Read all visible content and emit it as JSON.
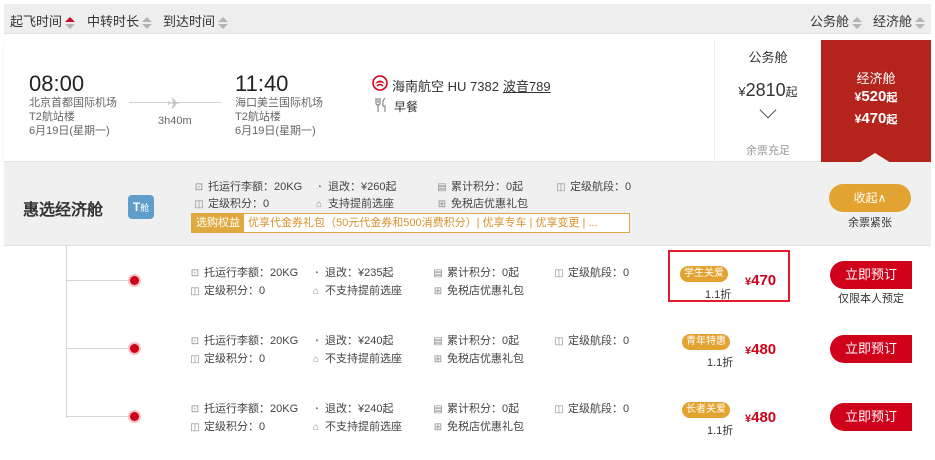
{
  "sort_bar": {
    "departure": "起飞时间",
    "transfer": "中转时长",
    "arrival": "到达时间",
    "business": "公务舱",
    "economy": "经济舱"
  },
  "flight": {
    "dep_time": "08:00",
    "dep_airport": "北京首都国际机场",
    "dep_terminal": "T2航站楼",
    "dep_date": "6月19日(星期一)",
    "duration": "3h40m",
    "arr_time": "11:40",
    "arr_airport": "海口美兰国际机场",
    "arr_terminal": "T2航站楼",
    "arr_date": "6月19日(星期一)",
    "airline": "海南航空 HU 7382",
    "aircraft": "波音789",
    "meal": "早餐",
    "business": {
      "label": "公务舱",
      "currency": "¥",
      "price": "2810",
      "suffix": "起",
      "seats": "余票充足"
    },
    "economy": {
      "label": "经济舱",
      "currency": "¥",
      "price1": "520",
      "price2": "470",
      "suffix": "起"
    }
  },
  "cabin": {
    "title": "惠选经济舱",
    "badge": "T",
    "badge_sub": "舱",
    "attrs": {
      "baggage": "托运行李额：20KG",
      "refund": "退改：¥260起",
      "points": "累计积分：0起",
      "segment": "定级航段：0",
      "grade_points": "定级积分：0",
      "seat": "支持提前选座",
      "dutyfree": "免税店优惠礼包"
    },
    "perk_tag": "选购权益",
    "perk_text": "优享代金券礼包（50元代金券和500消费积分）| 优享专车 | 优享变更 | ...",
    "collapse": "收起∧",
    "collapse_hint": "余票紧张"
  },
  "fares": [
    {
      "baggage": "托运行李额：20KG",
      "refund": "退改：¥235起",
      "points": "累计积分：0起",
      "segment": "定级航段：0",
      "grade_points": "定级积分：0",
      "seat": "不支持提前选座",
      "dutyfree": "免税店优惠礼包",
      "tag": "学生关爱",
      "discount": "1.1折",
      "currency": "¥",
      "price": "470",
      "book": "立即预订",
      "note": "仅限本人预定"
    },
    {
      "baggage": "托运行李额：20KG",
      "refund": "退改：¥240起",
      "points": "累计积分：0起",
      "segment": "定级航段：0",
      "grade_points": "定级积分：0",
      "seat": "不支持提前选座",
      "dutyfree": "免税店优惠礼包",
      "tag": "青年特惠",
      "discount": "1.1折",
      "currency": "¥",
      "price": "480",
      "book": "立即预订",
      "note": ""
    },
    {
      "baggage": "托运行李额：20KG",
      "refund": "退改：¥240起",
      "points": "累计积分：0起",
      "segment": "定级航段：0",
      "grade_points": "定级积分：0",
      "seat": "不支持提前选座",
      "dutyfree": "免税店优惠礼包",
      "tag": "长者关爱",
      "discount": "1.1折",
      "currency": "¥",
      "price": "480",
      "book": "立即预订",
      "note": ""
    }
  ],
  "colors": {
    "accent_red": "#d0021b",
    "economy_bg": "#b5241c",
    "tag_orange": "#e3a330",
    "badge_blue": "#5f9ec9"
  }
}
